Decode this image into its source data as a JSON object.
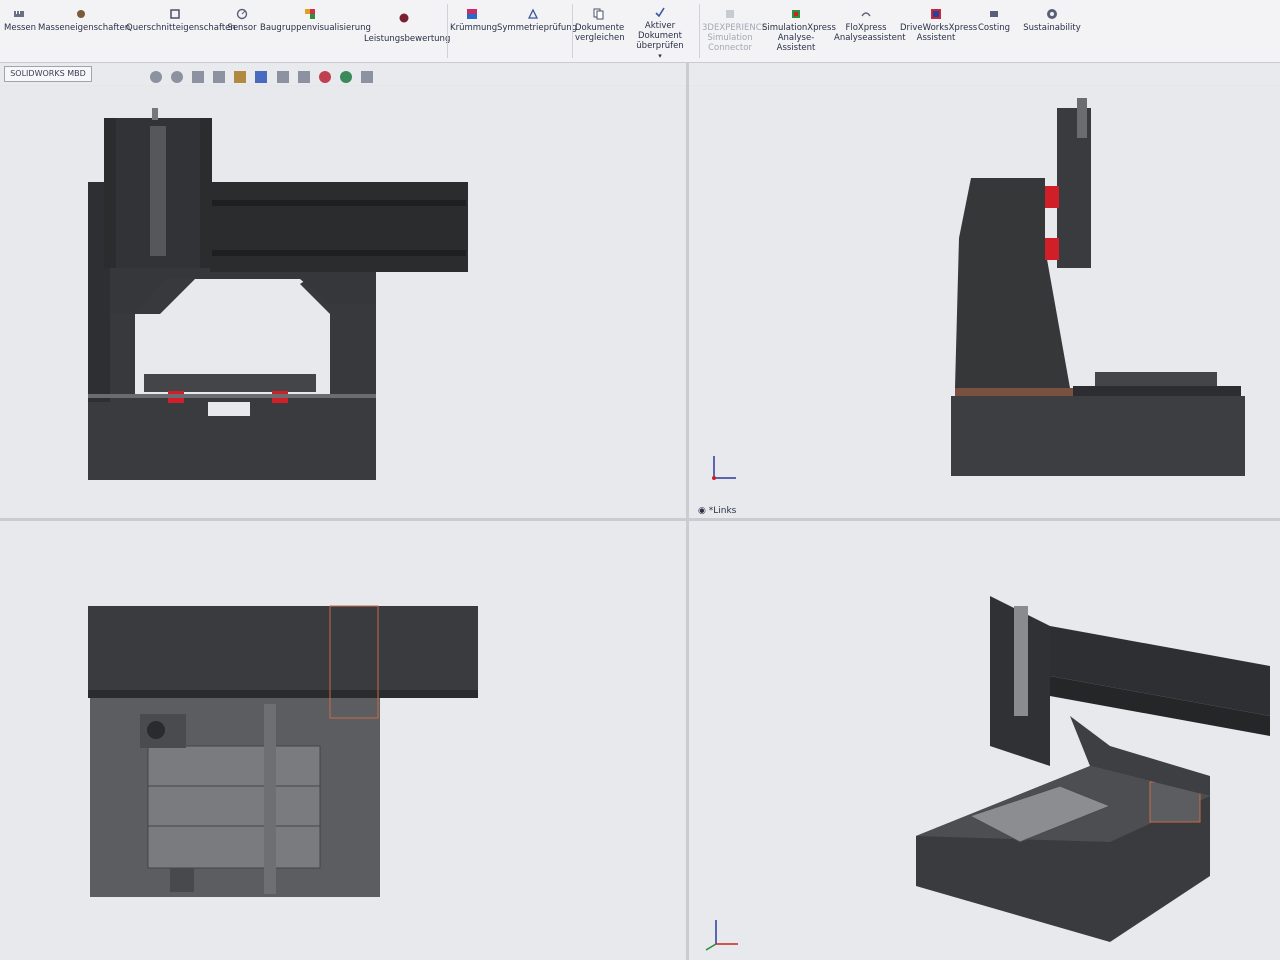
{
  "ribbon": {
    "tools": [
      {
        "label": "Messen",
        "icon": "ruler-icon"
      },
      {
        "label": "Masseneigenschaften",
        "icon": "scale-icon"
      },
      {
        "label": "Querschnitteigenschaften",
        "icon": "section-icon"
      },
      {
        "label": "Sensor",
        "icon": "sensor-icon"
      },
      {
        "label": "Baugruppenvisualisierung",
        "icon": "assembly-visual-icon"
      },
      {
        "label": "Leistungsbewertung",
        "icon": "performance-icon"
      },
      {
        "label": "Krümmung",
        "icon": "curvature-icon"
      },
      {
        "label": "Symmetrieprüfung",
        "icon": "symmetry-icon"
      },
      {
        "label_l1": "Dokumente",
        "label_l2": "vergleichen",
        "icon": "compare-icon"
      },
      {
        "label_l1": "Aktiver Dokument",
        "label_l2": "überprüfen",
        "icon": "check-document-icon"
      },
      {
        "label_l1": "3DEXPERIENCE",
        "label_l2": "Simulation",
        "label_l3": "Connector",
        "icon": "3dx-icon",
        "disabled": true
      },
      {
        "label_l1": "SimulationXpress",
        "label_l2": "Analyse-Assistent",
        "icon": "simxpress-icon"
      },
      {
        "label_l1": "FloXpress",
        "label_l2": "Analyseassistent",
        "icon": "floxpress-icon"
      },
      {
        "label_l1": "DriveWorksXpress",
        "label_l2": "Assistent",
        "icon": "driveworks-icon"
      },
      {
        "label": "Costing",
        "icon": "costing-icon"
      },
      {
        "label": "Sustainability",
        "icon": "sustainability-icon"
      }
    ]
  },
  "tabs": {
    "active": "SOLIDWORKS MBD"
  },
  "viewport": {
    "top_right_label": "*Links"
  },
  "colors": {
    "steel": "#3a3b3e",
    "steel_dark": "#262729",
    "steel_light": "#56575b",
    "red": "#d11f2a",
    "background": "#e7e9ed",
    "gray_part": "#5c5d60"
  }
}
